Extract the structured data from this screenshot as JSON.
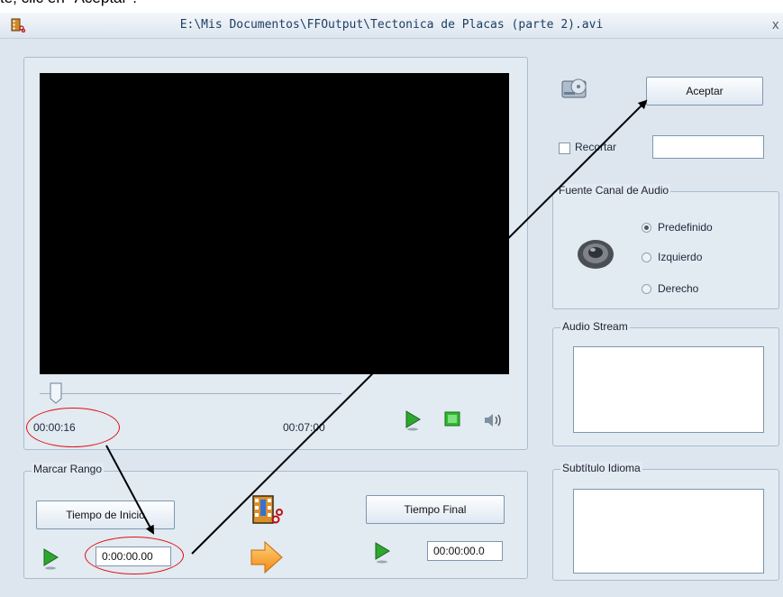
{
  "instruction": "te, clic en \"Aceptar\".",
  "window": {
    "title": "E:\\Mis Documentos\\FFOutput\\Tectonica de Placas (parte 2).avi",
    "close_glyph": "x"
  },
  "player": {
    "current_time": "00:00:16",
    "total_time": "00:07:00",
    "seek_position": 0.04
  },
  "controls": {
    "accept_label": "Aceptar",
    "crop_label": "Recortar",
    "crop_checked": false,
    "crop_value": ""
  },
  "audio_channel": {
    "legend": "Fuente Canal de Audio",
    "options": [
      "Predefinido",
      "Izquierdo",
      "Derecho"
    ],
    "selected": "Predefinido"
  },
  "audio_stream": {
    "legend": "Audio Stream"
  },
  "subtitle": {
    "legend": "Subtítulo Idioma"
  },
  "range": {
    "legend": "Marcar Rango",
    "start_button": "Tiempo de Inicio",
    "end_button": "Tiempo Final",
    "start_value": "0:00:00.00",
    "end_value": "00:00:00.0"
  },
  "icons": {
    "app": "film-scissors-icon",
    "disc": "cd-drive-icon",
    "speaker": "speaker-icon",
    "volume": "volume-icon",
    "play": "play-icon",
    "stop": "stop-icon",
    "arrow": "arrow-right-icon"
  },
  "colors": {
    "annotation_circle": "#e01010",
    "annotation_arrow": "#000000",
    "video_bg": "#000000"
  }
}
